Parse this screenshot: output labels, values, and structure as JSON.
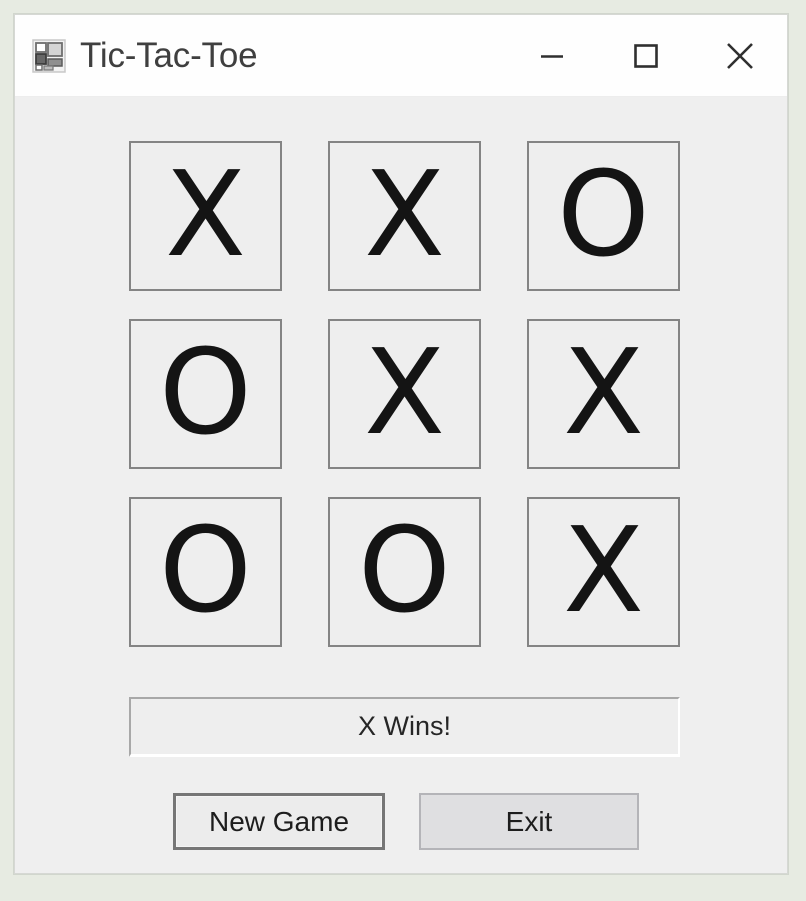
{
  "window": {
    "title": "Tic-Tac-Toe",
    "icon": "winforms-app-icon",
    "client_bg": "#efefef",
    "titlebar_bg": "#fefefe",
    "desktop_bg": "#e7ebe2",
    "controls": [
      {
        "name": "minimize",
        "glyph": "minimize-icon",
        "label": "—"
      },
      {
        "name": "maximize",
        "glyph": "maximize-icon",
        "label": "□"
      },
      {
        "name": "close",
        "glyph": "close-icon",
        "label": "✕"
      }
    ]
  },
  "board": {
    "rows": 3,
    "columns": 3,
    "cell_border_color": "#848484",
    "mark_color": "#141414",
    "cells": [
      {
        "index": 0,
        "row": 0,
        "col": 0,
        "mark": "X"
      },
      {
        "index": 1,
        "row": 0,
        "col": 1,
        "mark": "X"
      },
      {
        "index": 2,
        "row": 0,
        "col": 2,
        "mark": "O"
      },
      {
        "index": 3,
        "row": 1,
        "col": 0,
        "mark": "O"
      },
      {
        "index": 4,
        "row": 1,
        "col": 1,
        "mark": "X"
      },
      {
        "index": 5,
        "row": 1,
        "col": 2,
        "mark": "X"
      },
      {
        "index": 6,
        "row": 2,
        "col": 0,
        "mark": "O"
      },
      {
        "index": 7,
        "row": 2,
        "col": 1,
        "mark": "O"
      },
      {
        "index": 8,
        "row": 2,
        "col": 2,
        "mark": "X"
      }
    ]
  },
  "status": {
    "text": "X Wins!"
  },
  "buttons": {
    "new_game": "New Game",
    "exit": "Exit"
  }
}
